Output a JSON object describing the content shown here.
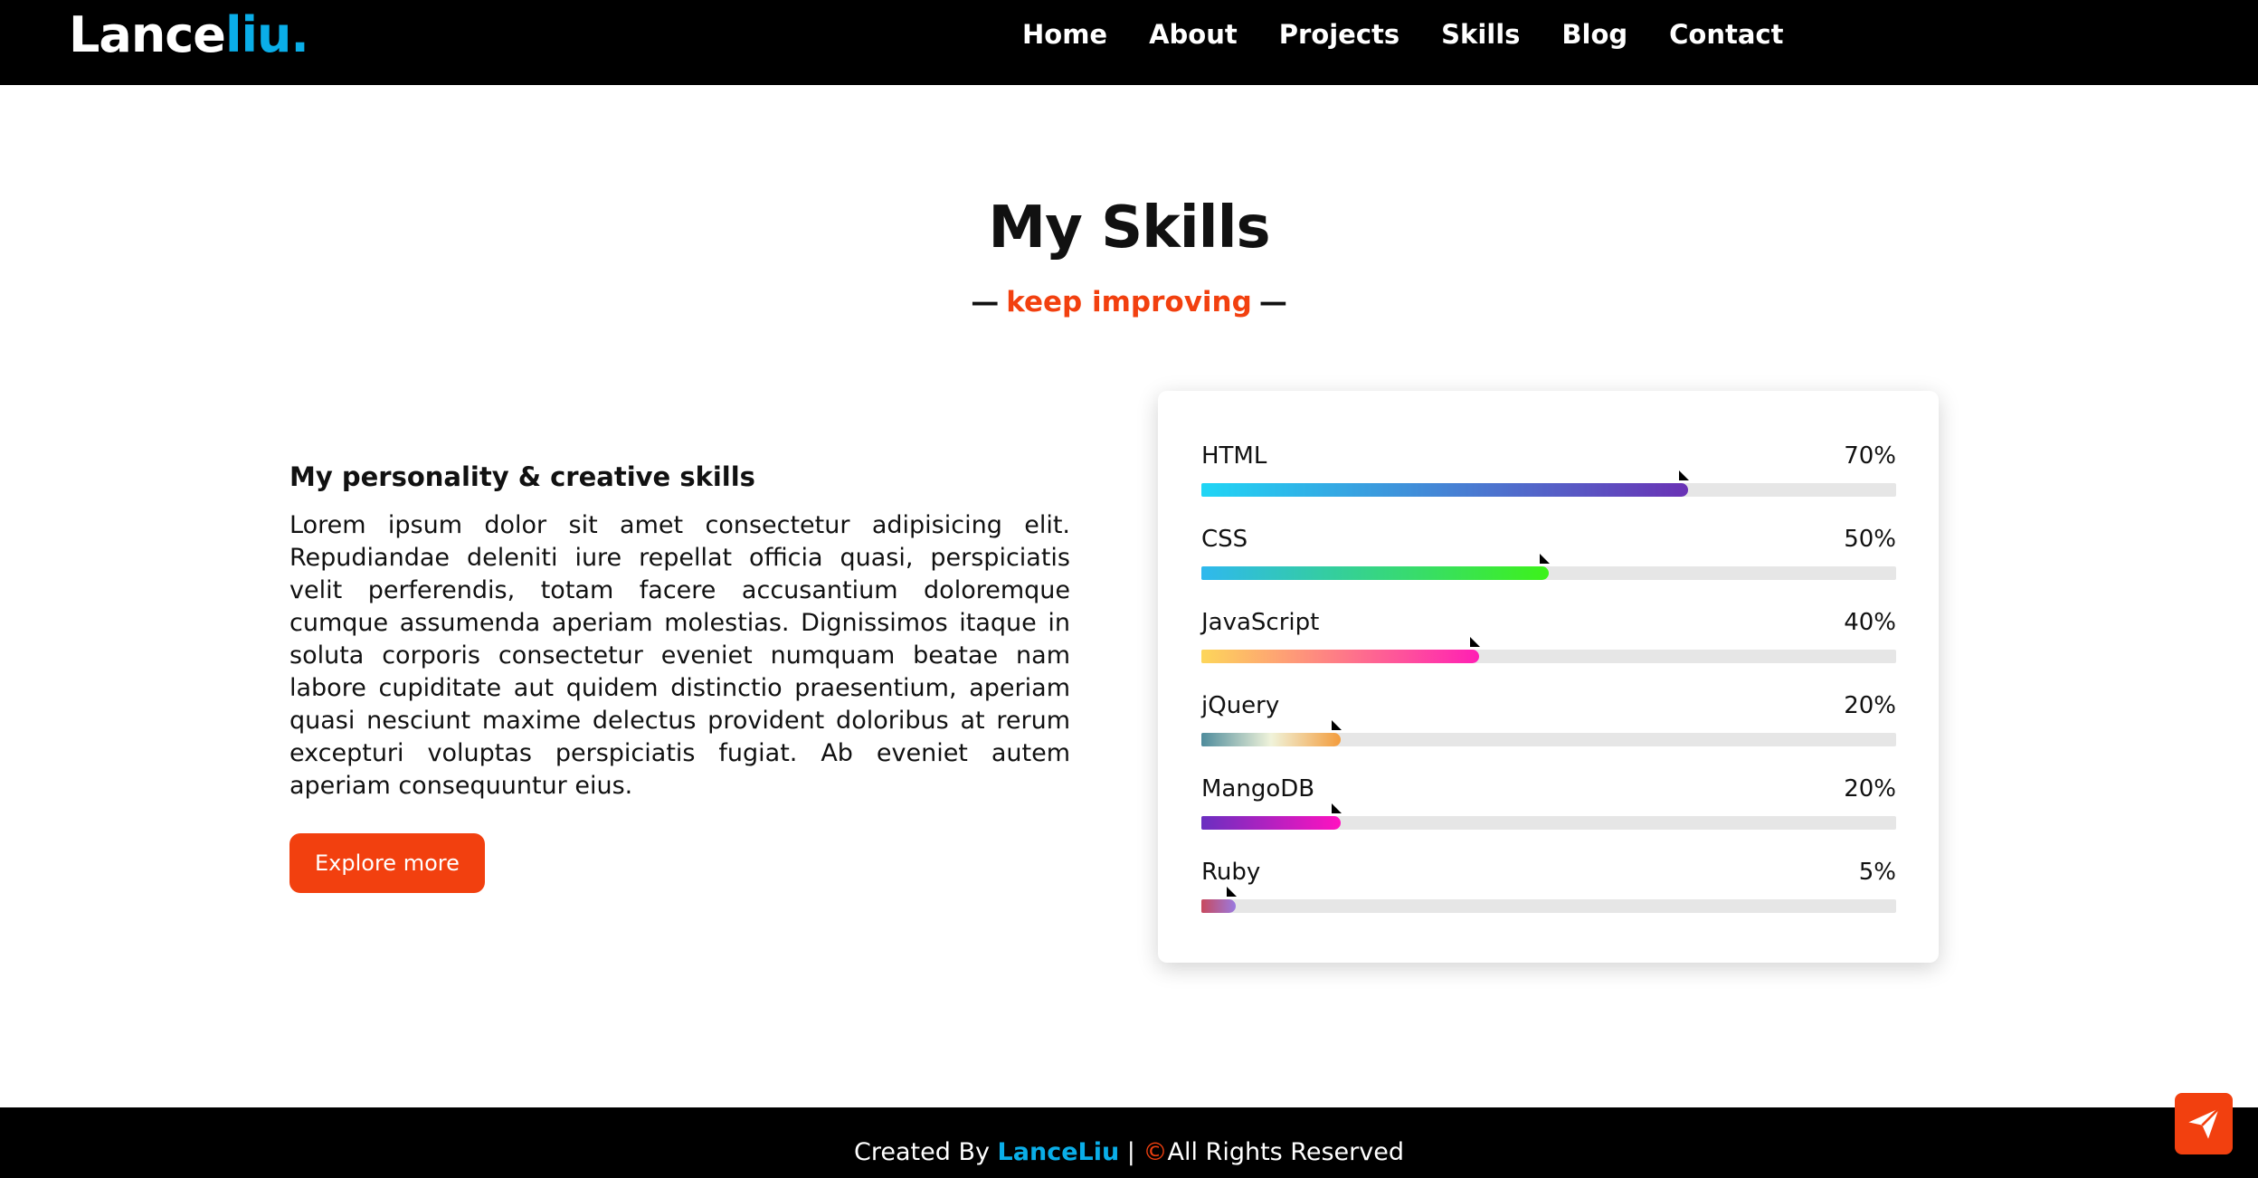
{
  "nav": {
    "logo_main": "Lance",
    "logo_accent": "liu.",
    "items": [
      "Home",
      "About",
      "Projects",
      "Skills",
      "Blog",
      "Contact"
    ]
  },
  "section": {
    "title": "My Skills",
    "sub_dash": "—",
    "subtitle": "keep improving"
  },
  "about": {
    "title": "My personality & creative skills",
    "text": "Lorem ipsum dolor sit amet consectetur adipisicing elit. Repudiandae deleniti iure repellat officia quasi, perspiciatis velit perferendis, totam facere accusantium doloremque cumque assumenda aperiam molestias. Dignissimos itaque in soluta corporis consectetur eveniet numquam beatae nam labore cupiditate aut quidem distinctio praesentium, aperiam quasi nesciunt maxime delectus provident doloribus at rerum excepturi voluptas perspiciatis fugiat. Ab eveniet autem aperiam consequuntur eius.",
    "button": "Explore more"
  },
  "skills": [
    {
      "name": "HTML",
      "percent": "70%",
      "value": 0.7,
      "gradient": [
        "#20d6f5",
        "#6a32b5"
      ]
    },
    {
      "name": "CSS",
      "percent": "50%",
      "value": 0.5,
      "gradient": [
        "#2fb8ee",
        "#3df21a"
      ]
    },
    {
      "name": "JavaScript",
      "percent": "40%",
      "value": 0.4,
      "gradient": [
        "#fdd65a",
        "#ff1fb4"
      ]
    },
    {
      "name": "jQuery",
      "percent": "20%",
      "value": 0.2,
      "gradient": [
        "#4f8c9c",
        "#f0f3da",
        "#f39c3c"
      ]
    },
    {
      "name": "MangoDB",
      "percent": "20%",
      "value": 0.2,
      "gradient": [
        "#6a2fc0",
        "#ff12c0"
      ]
    },
    {
      "name": "Ruby",
      "percent": "5%",
      "value": 0.05,
      "gradient": [
        "#c84a5e",
        "#9a7ae0"
      ]
    }
  ],
  "footer": {
    "created_by": "Created By",
    "brand": "LanceLiu",
    "separator": "|",
    "copy_symbol": "©",
    "rights": "All Rights Reserved"
  },
  "colors": {
    "accent": "#f2400f",
    "brand_blue": "#0aaee8"
  },
  "icons": {
    "send": "paper-plane-icon"
  }
}
